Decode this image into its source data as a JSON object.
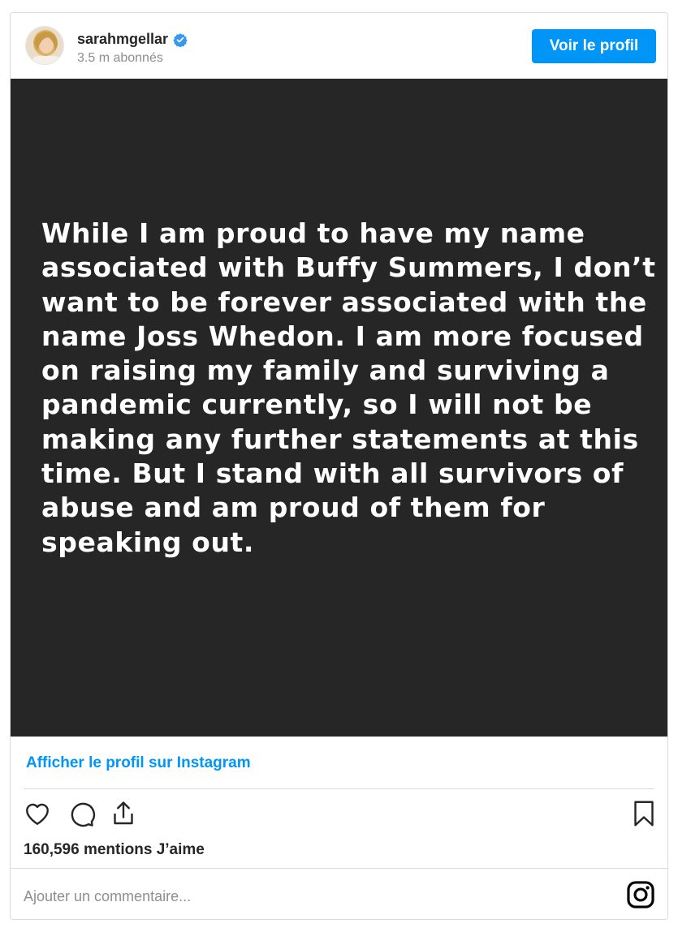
{
  "header": {
    "username": "sarahmgellar",
    "followers": "3.5 m abonnés",
    "profile_button": "Voir le profil"
  },
  "post": {
    "text": "While I am proud to have my name\nassociated with Buffy Summers, I don’t\nwant to be forever associated with the\nname Joss Whedon. I am more focused\non raising my family and surviving a\npandemic currently, so I will not be\nmaking any further statements at this\ntime. But I stand with all survivors of\nabuse and am proud of them for\nspeaking out."
  },
  "footer": {
    "view_link": "Afficher le profil sur Instagram",
    "likes": "160,596 mentions J’aime",
    "comment_placeholder": "Ajouter un commentaire..."
  },
  "icons": {
    "verified": "verified-badge-icon",
    "like": "heart-icon",
    "comment": "comment-icon",
    "share": "share-icon",
    "save": "bookmark-icon",
    "instagram": "instagram-icon"
  },
  "colors": {
    "accent": "#0095f6",
    "post_background": "#262626"
  }
}
